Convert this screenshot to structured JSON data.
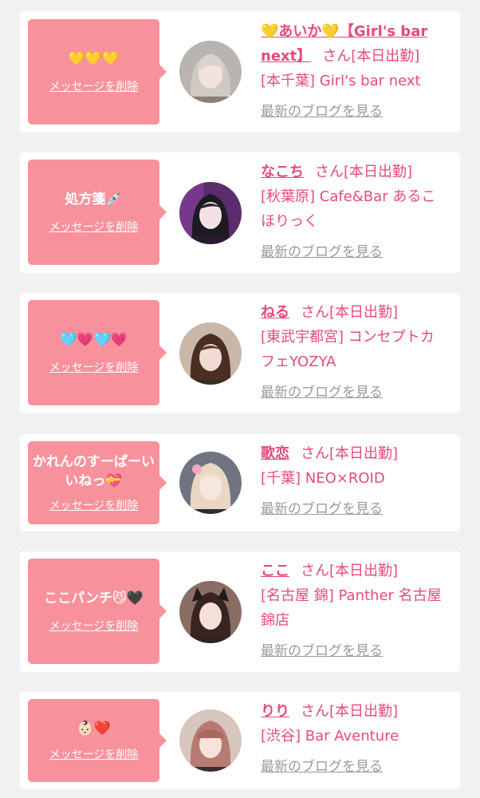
{
  "delete_label": "メッセージを削除",
  "blog_label": "最新のブログを見る",
  "san_label": "さん",
  "colors": {
    "background": "#f1f1f1",
    "card": "#ffffff",
    "bubble": "#f7929c",
    "accent_text": "#e84a7a",
    "muted_link": "#9a9a9a"
  },
  "entries": [
    {
      "message": "💛💛💛",
      "name": "💛あいか💛【Girl's bar next】",
      "status": "[本日出勤]",
      "shop": "[本千葉] Girl's bar next",
      "avatar_icon": "profile-photo"
    },
    {
      "message": "処方箋💉",
      "name": "なこち",
      "status": "[本日出勤]",
      "shop": "[秋葉原] Cafe&Bar あるこほりっく",
      "avatar_icon": "profile-photo"
    },
    {
      "message": "🩵💗🩵💗",
      "name": "ねる",
      "status": "[本日出勤]",
      "shop": "[東武宇都宮] コンセプトカフェYOZYA",
      "avatar_icon": "profile-photo"
    },
    {
      "message": "かれんのすーぱーいいねっ💝",
      "name": "歌恋",
      "status": "[本日出勤]",
      "shop": "[千葉] NEO×ROID",
      "avatar_icon": "profile-photo"
    },
    {
      "message": "ここパンチ😼🖤",
      "name": "ここ",
      "status": "[本日出勤]",
      "shop": "[名古屋 錦] Panther 名古屋錦店",
      "avatar_icon": "profile-photo"
    },
    {
      "message": "👶🏻❤️",
      "name": "りり",
      "status": "[本日出勤]",
      "shop": "[渋谷] Bar Aventure",
      "avatar_icon": "profile-photo"
    }
  ]
}
